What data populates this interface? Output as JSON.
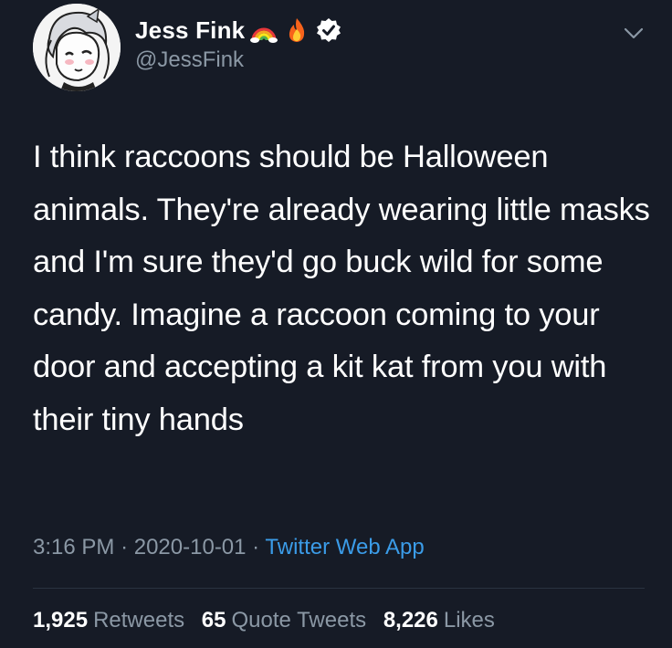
{
  "author": {
    "display_name": "Jess Fink",
    "handle": "@JessFink"
  },
  "tweet": {
    "text": "I think raccoons should be Halloween animals. They're already wearing little masks and I'm sure they'd go buck wild for some candy. Imagine a raccoon coming to your door and accepting a kit kat from you with their tiny hands",
    "time": "3:16 PM",
    "date": "2020-10-01",
    "separator": "·",
    "source": "Twitter Web App"
  },
  "stats": {
    "retweets_count": "1,925",
    "retweets_label": "Retweets",
    "quotes_count": "65",
    "quotes_label": "Quote Tweets",
    "likes_count": "8,226",
    "likes_label": "Likes"
  },
  "icons": {
    "name_emoji_1": "rainbow-icon",
    "name_emoji_2": "fire-icon",
    "badge": "verified-badge-icon",
    "menu": "chevron-down-icon"
  },
  "colors": {
    "background": "#161b26",
    "text": "#ffffff",
    "muted": "#8b98a5",
    "link": "#3b9ce8"
  }
}
